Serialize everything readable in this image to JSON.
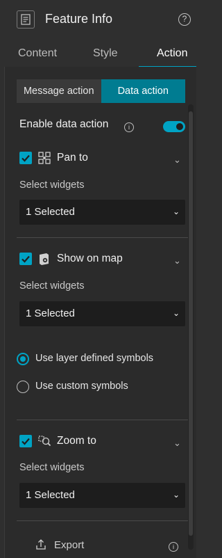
{
  "header": {
    "title": "Feature Info",
    "help_icon": "question-circle-icon",
    "app_icon": "feature-info-icon"
  },
  "tabs": [
    {
      "label": "Content",
      "active": false
    },
    {
      "label": "Style",
      "active": false
    },
    {
      "label": "Action",
      "active": true
    }
  ],
  "action_mode": {
    "message_action": "Message action",
    "data_action": "Data action",
    "selected": "Data action"
  },
  "enable_data_action": {
    "label": "Enable data action",
    "enabled": true
  },
  "actions": [
    {
      "label": "Pan to",
      "checked": true,
      "icon": "pan-to-icon",
      "select_label": "Select widgets",
      "select_value": "1 Selected"
    },
    {
      "label": "Show on map",
      "checked": true,
      "icon": "show-on-map-icon",
      "select_label": "Select widgets",
      "select_value": "1 Selected"
    },
    {
      "label": "Zoom to",
      "checked": true,
      "icon": "zoom-to-icon",
      "select_label": "Select widgets",
      "select_value": "1 Selected"
    }
  ],
  "symbol_options": [
    {
      "label": "Use layer defined symbols",
      "selected": true
    },
    {
      "label": "Use custom symbols",
      "selected": false
    }
  ],
  "footer": {
    "export_label": "Export",
    "export_icon": "export-icon"
  },
  "colors": {
    "accent": "#00a3c4",
    "accent_dark": "#007c91",
    "background": "#2f2f2f"
  }
}
